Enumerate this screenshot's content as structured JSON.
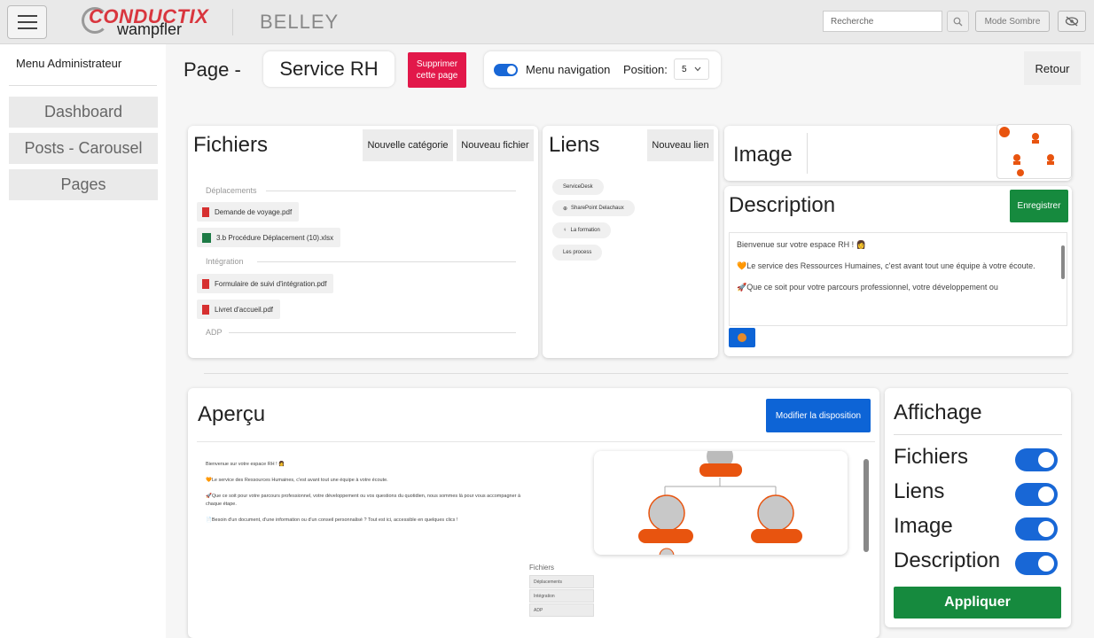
{
  "topbar": {
    "brand_top": "CONDUCTIX",
    "brand_bottom": "wampfler",
    "site_name": "BELLEY",
    "search_placeholder": "Recherche",
    "dark_mode_label": "Mode Sombre",
    "icons": [
      "menu-icon",
      "search-icon",
      "eye-slash-icon"
    ]
  },
  "sidebar": {
    "title": "Menu Administrateur",
    "items": [
      {
        "label": "Dashboard"
      },
      {
        "label": "Posts - Carousel"
      },
      {
        "label": "Pages"
      }
    ]
  },
  "header": {
    "page_label": "Page -",
    "page_name": "Service RH",
    "delete_label_1": "Supprimer",
    "delete_label_2": "cette page",
    "nav_label": "Menu navigation",
    "nav_enabled": true,
    "position_label": "Position:",
    "position_value": "5",
    "back_label": "Retour"
  },
  "fichiers": {
    "title": "Fichiers",
    "new_category": "Nouvelle catégorie",
    "new_file": "Nouveau fichier",
    "sections": [
      {
        "name": "Déplacements",
        "files": [
          {
            "name": "Demande de voyage.pdf",
            "type": "pdf"
          },
          {
            "name": "3.b Procédure Déplacement (10).xlsx",
            "type": "xlsx"
          }
        ]
      },
      {
        "name": "Intégration",
        "files": [
          {
            "name": "Formulaire de suivi d'intégration.pdf",
            "type": "pdf"
          },
          {
            "name": "Livret d'accueil.pdf",
            "type": "pdf"
          }
        ]
      },
      {
        "name": "ADP",
        "files": []
      }
    ]
  },
  "liens": {
    "title": "Liens",
    "new_link": "Nouveau lien",
    "items": [
      {
        "label": "ServiceDesk",
        "icon": ""
      },
      {
        "label": "SharePoint Delachaux",
        "icon": "⊕"
      },
      {
        "label": "La formation",
        "icon": "♀"
      },
      {
        "label": "Les process",
        "icon": ""
      }
    ]
  },
  "image": {
    "title": "Image"
  },
  "description": {
    "title": "Description",
    "save_label": "Enregistrer",
    "paragraphs": [
      "Bienvenue sur votre espace RH ! 👩",
      "🧡Le service des Ressources Humaines, c'est avant tout une équipe à votre écoute.",
      "🚀Que ce soit pour votre parcours professionnel, votre développement ou"
    ]
  },
  "apercu": {
    "title": "Aperçu",
    "modify_label": "Modifier la disposition",
    "paragraphs": [
      "Bienvenue sur votre espace RH ! 👩",
      "🧡Le service des Ressources Humaines, c'est avant tout une équipe à votre écoute.",
      "🚀Que ce soit pour votre parcours professionnel, votre développement ou vos questions du quotidien, nous sommes là pour vous accompagner à chaque étape.",
      "📄Besoin d'un document, d'une information ou d'un conseil personnalisé ? Tout est ici, accessible en quelques clics !"
    ],
    "files_title": "Fichiers",
    "files_rows": [
      "Déplacements",
      "Intégration",
      "ADP"
    ]
  },
  "affichage": {
    "title": "Affichage",
    "toggles": [
      {
        "label": "Fichiers",
        "on": true
      },
      {
        "label": "Liens",
        "on": true
      },
      {
        "label": "Image",
        "on": true
      },
      {
        "label": "Description",
        "on": true
      }
    ],
    "apply_label": "Appliquer"
  },
  "colors": {
    "danger": "#e2184a",
    "primary": "#0d64d6",
    "success": "#168a3e",
    "accent_orange": "#e8540f"
  }
}
